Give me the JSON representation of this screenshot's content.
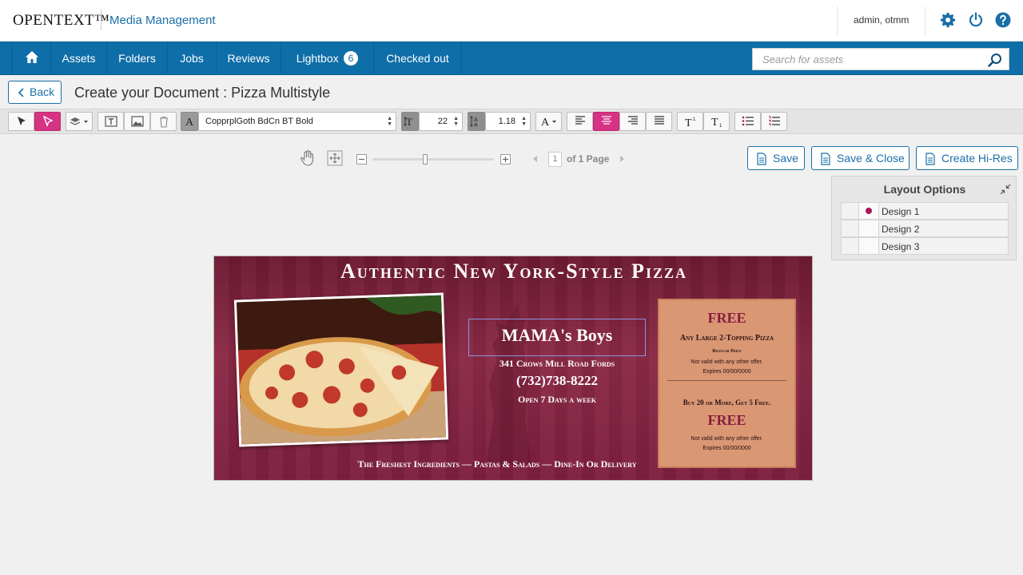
{
  "header": {
    "brand": "OPENTEXT™",
    "product": "Media Management",
    "user": "admin, otmm",
    "icons": [
      "gear-icon",
      "power-icon",
      "help-icon"
    ]
  },
  "nav": {
    "home_icon": "home-icon",
    "items": [
      {
        "label": "Assets"
      },
      {
        "label": "Folders"
      },
      {
        "label": "Jobs"
      },
      {
        "label": "Reviews"
      },
      {
        "label": "Lightbox",
        "badge": "6"
      },
      {
        "label": "Checked out"
      }
    ],
    "search_placeholder": "Search for assets"
  },
  "titlebar": {
    "back_label": "Back",
    "title": "Create your Document : Pizza Multistyle"
  },
  "toolbar": {
    "font_family": "CopprplGoth BdCn BT Bold",
    "font_size": "22",
    "line_spacing": "1.18",
    "text_align_active": "center",
    "accent_color": "#d63384"
  },
  "view": {
    "page_current": "1",
    "page_text": "of 1 Page"
  },
  "actions": {
    "save": "Save",
    "save_close": "Save & Close",
    "create_hires": "Create Hi-Res"
  },
  "layout_options": {
    "title": "Layout Options",
    "designs": [
      {
        "label": "Design 1",
        "selected": true
      },
      {
        "label": "Design 2",
        "selected": false
      },
      {
        "label": "Design 3",
        "selected": false
      }
    ]
  },
  "document": {
    "headline": "Authentic New York-Style Pizza",
    "business_name": "MAMA's Boys",
    "address": "341 Crows Mill Road Fords",
    "phone": "(732)738-8222",
    "hours": "Open 7 Days a week",
    "tagline": "The Freshest Ingredients — Pastas & Salads — Dine-In Or Delivery",
    "coupon": {
      "free1": "FREE",
      "offer1": "Any Large 2-Topping Pizza",
      "regular_price": "Regular Price",
      "not_valid1": "Not valid with any other offer.",
      "expires1": "Expires 00/00/0000",
      "offer2": "Buy 20 or More, Get 5 Free.",
      "free2": "FREE",
      "not_valid2": "Not valid with any other offer.",
      "expires2": "Expires 00/00/0000"
    }
  }
}
